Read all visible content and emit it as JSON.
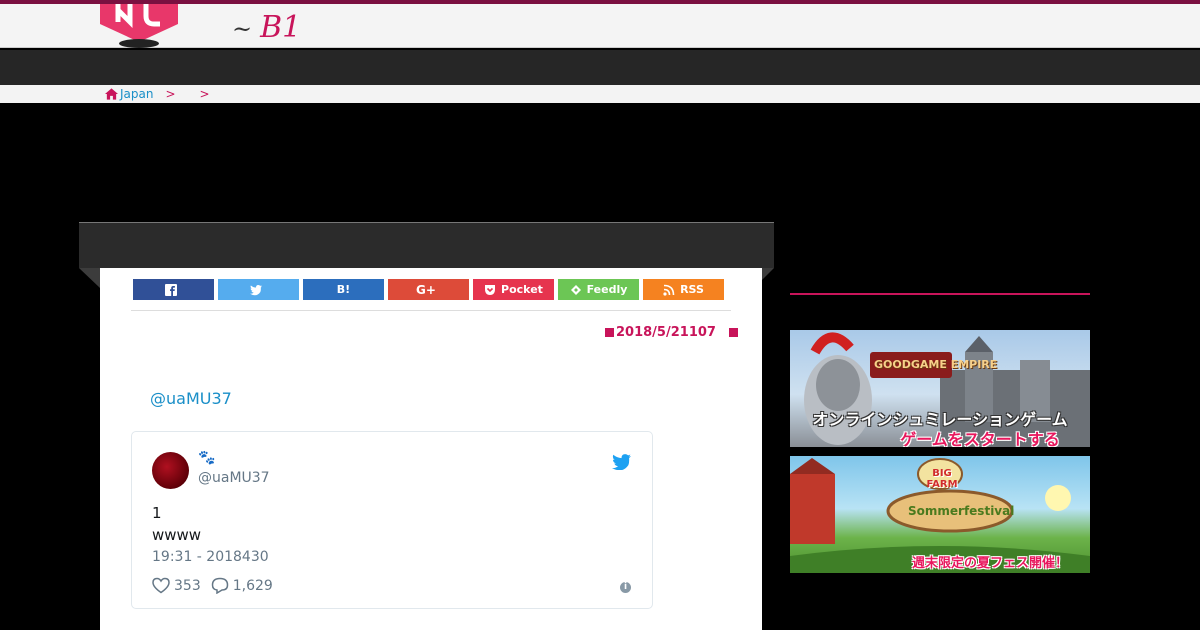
{
  "header": {
    "tagline": "B1",
    "tagline_tilde": "~",
    "accent_color": "#c8145a"
  },
  "breadcrumb": {
    "home_icon": "home-icon",
    "items": [
      "Japan"
    ],
    "separator": ">"
  },
  "share_buttons": [
    {
      "label": "",
      "icon": "facebook-icon",
      "color": "#305097"
    },
    {
      "label": "",
      "icon": "twitter-icon",
      "color": "#55acee"
    },
    {
      "label": "B!",
      "icon": "hatena-icon",
      "color": "#2c6ebd"
    },
    {
      "label": "",
      "icon": "google-plus-icon",
      "color": "#dd4b39"
    },
    {
      "label": "Pocket",
      "icon": "pocket-icon",
      "color": "#e6344e"
    },
    {
      "label": "Feedly",
      "icon": "feedly-icon",
      "color": "#6cc655"
    },
    {
      "label": "RSS",
      "icon": "rss-icon",
      "color": "#f58220"
    }
  ],
  "article": {
    "date": "2018/5/21107",
    "mention": "@uaMU37"
  },
  "tweet": {
    "user_name": "🐾",
    "handle": "@uaMU37",
    "lines": [
      "1",
      "wwww"
    ],
    "timestamp": "19:31 - 2018430",
    "likes": "353",
    "replies": "1,629",
    "info_glyph": "i"
  },
  "sidebar": {
    "ads": [
      {
        "brand": "GOODGAME EMPIRE",
        "line1": "オンラインシュミレーションゲーム",
        "line2": "ゲームをスタートする"
      },
      {
        "brand": "BIG FARM",
        "subtitle": "Sommerfestival",
        "line1": "週末限定の夏フェス開催！"
      }
    ]
  }
}
